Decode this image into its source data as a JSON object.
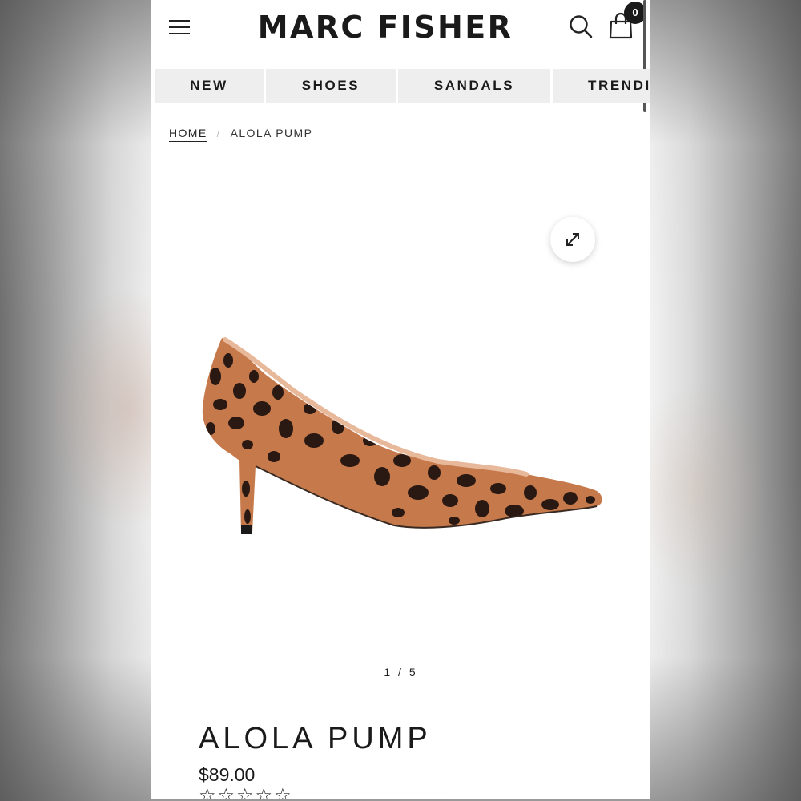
{
  "header": {
    "brand": "MARC FISHER",
    "cart_count": "0"
  },
  "nav": {
    "items": [
      "NEW",
      "SHOES",
      "SANDALS",
      "TRENDI"
    ]
  },
  "breadcrumb": {
    "home": "HOME",
    "separator": "/",
    "current": "ALOLA PUMP"
  },
  "gallery": {
    "pager": "1 / 5"
  },
  "product": {
    "name": "ALOLA PUMP",
    "price": "$89.00",
    "rating_stars": "☆☆☆☆☆"
  },
  "colors": {
    "text": "#1a1a1a",
    "nav_bg": "#eeeeee",
    "leopard_base": "#c67a4b",
    "leopard_spots": "#2a1812"
  },
  "icons": [
    "menu-icon",
    "search-icon",
    "shopping-bag-icon",
    "expand-icon"
  ]
}
